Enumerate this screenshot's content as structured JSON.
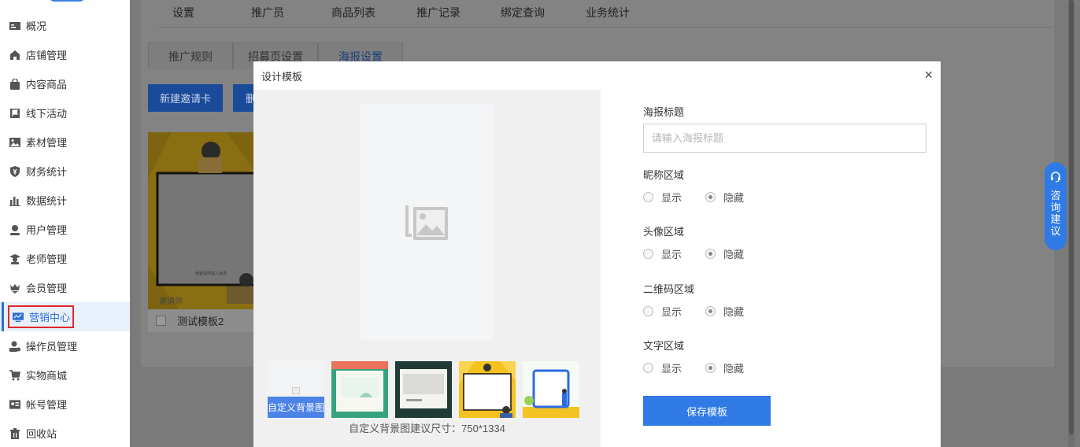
{
  "sidebar": {
    "items": [
      {
        "label": "概况",
        "icon": "overview-icon"
      },
      {
        "label": "店铺管理",
        "icon": "store-icon"
      },
      {
        "label": "内容商品",
        "icon": "bag-icon"
      },
      {
        "label": "线下活动",
        "icon": "flag-icon"
      },
      {
        "label": "素材管理",
        "icon": "image-icon"
      },
      {
        "label": "财务统计",
        "icon": "yen-shield-icon"
      },
      {
        "label": "数据统计",
        "icon": "bar-chart-icon"
      },
      {
        "label": "用户管理",
        "icon": "user-icon"
      },
      {
        "label": "老师管理",
        "icon": "teacher-icon"
      },
      {
        "label": "会员管理",
        "icon": "crown-icon"
      },
      {
        "label": "营销中心",
        "icon": "trend-monitor-icon",
        "active": true
      },
      {
        "label": "操作员管理",
        "icon": "operator-icon"
      },
      {
        "label": "实物商城",
        "icon": "cart-icon"
      },
      {
        "label": "帐号管理",
        "icon": "id-card-icon"
      },
      {
        "label": "回收站",
        "icon": "trash-icon"
      }
    ]
  },
  "top_tabs": [
    "设置",
    "推广员",
    "商品列表",
    "推广记录",
    "绑定查询",
    "业务统计"
  ],
  "sub_tabs": [
    {
      "label": "推广规则"
    },
    {
      "label": "招募页设置"
    },
    {
      "label": "海报设置",
      "active": true
    }
  ],
  "toolbar": {
    "new_card": "新建邀请卡",
    "second_btn_partial": "删"
  },
  "card": {
    "label": "测试模板2",
    "caption": "我邀请你加入会员",
    "bottom_text": "邀请你"
  },
  "float_button": {
    "chars": [
      "咨",
      "询",
      "建",
      "议"
    ]
  },
  "modal": {
    "title": "设计模板",
    "close": "×",
    "custom_bg_label": "自定义背景图",
    "size_hint": "自定义背景图建议尺寸：750*1334",
    "poster_title_label": "海报标题",
    "poster_title_placeholder": "请输入海报标题",
    "sections": [
      {
        "label": "昵称区域",
        "show": "显示",
        "hide": "隐藏",
        "selected": "hide"
      },
      {
        "label": "头像区域",
        "show": "显示",
        "hide": "隐藏",
        "selected": "hide"
      },
      {
        "label": "二维码区域",
        "show": "显示",
        "hide": "隐藏",
        "selected": "hide"
      },
      {
        "label": "文字区域",
        "show": "显示",
        "hide": "隐藏",
        "selected": "hide"
      }
    ],
    "save": "保存模板"
  },
  "colors": {
    "accent": "#2f7ae5",
    "highlight_border": "#e0262b",
    "overlay": "#7a7a7a"
  }
}
